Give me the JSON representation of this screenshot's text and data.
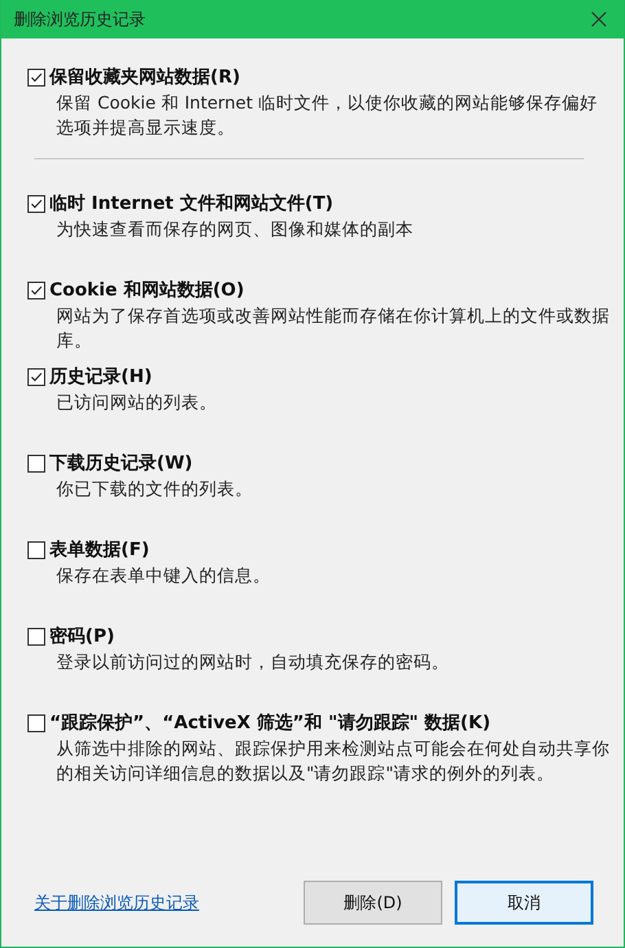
{
  "window": {
    "title": "删除浏览历史记录"
  },
  "groups": [
    [
      {
        "label": "保留收藏夹网站数据(R)",
        "description": "保留 Cookie 和 Internet 临时文件，以使你收藏的网站能够保存偏好选项并提高显示速度。",
        "checked": true
      }
    ],
    [
      {
        "label": "临时 Internet 文件和网站文件(T)",
        "description": "为快速查看而保存的网页、图像和媒体的副本",
        "checked": true
      },
      {
        "label": "Cookie 和网站数据(O)",
        "description": "网站为了保存首选项或改善网站性能而存储在你计算机上的文件或数据库。",
        "checked": true
      },
      {
        "label": "历史记录(H)",
        "description": "已访问网站的列表。",
        "checked": true
      },
      {
        "label": "下载历史记录(W)",
        "description": "你已下载的文件的列表。",
        "checked": false
      },
      {
        "label": "表单数据(F)",
        "description": "保存在表单中键入的信息。",
        "checked": false
      },
      {
        "label": "密码(P)",
        "description": "登录以前访问过的网站时，自动填充保存的密码。",
        "checked": false
      },
      {
        "label": "“跟踪保护”、“ActiveX 筛选”和 \"请勿跟踪\" 数据(K)",
        "description": "从筛选中排除的网站、跟踪保护用来检测站点可能会在何处自动共享你的相关访问详细信息的数据以及\"请勿跟踪\"请求的例外的列表。",
        "checked": false
      }
    ]
  ],
  "footer": {
    "link": "关于删除浏览历史记录",
    "buttons": [
      {
        "label": "删除(D)",
        "default": false
      },
      {
        "label": "取消",
        "default": true
      }
    ]
  }
}
